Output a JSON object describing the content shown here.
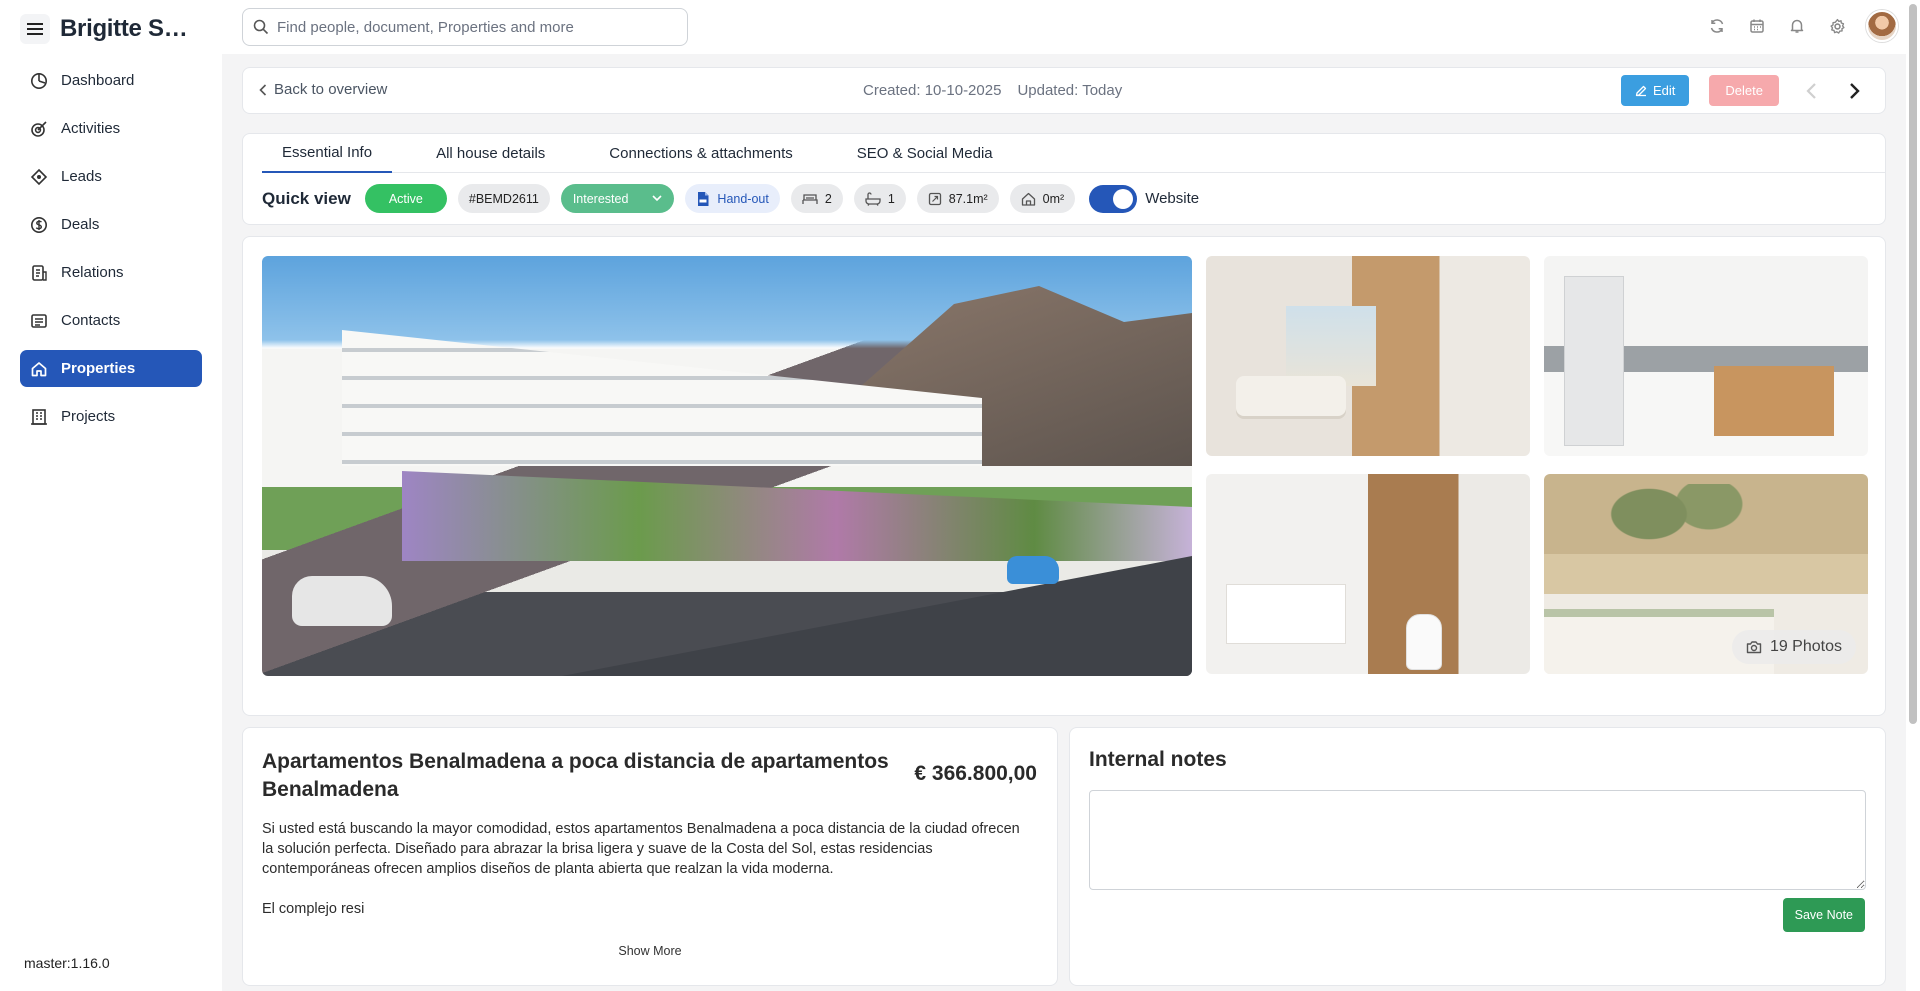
{
  "app": {
    "user_name": "Brigitte Sch..."
  },
  "sidebar": {
    "items": [
      {
        "label": "Dashboard",
        "icon": "dashboard-icon"
      },
      {
        "label": "Activities",
        "icon": "activities-icon"
      },
      {
        "label": "Leads",
        "icon": "leads-icon"
      },
      {
        "label": "Deals",
        "icon": "deals-icon"
      },
      {
        "label": "Relations",
        "icon": "relations-icon"
      },
      {
        "label": "Contacts",
        "icon": "contacts-icon"
      },
      {
        "label": "Properties",
        "icon": "home-icon",
        "active": true
      },
      {
        "label": "Projects",
        "icon": "projects-icon"
      }
    ],
    "version": "master:1.16.0"
  },
  "search": {
    "placeholder": "Find people, document, Properties and more"
  },
  "topbar": {
    "icons": [
      "sync-icon",
      "calendar-icon",
      "bell-icon",
      "gear-icon",
      "avatar"
    ]
  },
  "header": {
    "back_label": "Back to overview",
    "created": "Created: 10-10-2025",
    "updated": "Updated: Today",
    "edit_label": "Edit",
    "delete_label": "Delete"
  },
  "tabs": [
    {
      "label": "Essential Info",
      "active": true
    },
    {
      "label": "All house details"
    },
    {
      "label": "Connections & attachments"
    },
    {
      "label": "SEO & Social Media"
    }
  ],
  "quick_view": {
    "label": "Quick view",
    "status": "Active",
    "reference": "#BEMD2611",
    "interest": "Interested",
    "handout": "Hand-out",
    "bedrooms": "2",
    "bathrooms": "1",
    "living_area": "87.1m²",
    "plot_area": "0m²",
    "website_label": "Website",
    "website_enabled": true
  },
  "gallery": {
    "photos_label": "19 Photos"
  },
  "property": {
    "title": "Apartamentos Benalmadena a poca distancia de apartamentos Benalmadena",
    "price": "€ 366.800,00",
    "description_p1": "Si usted está buscando la mayor comodidad, estos apartamentos Benalmadena a poca distancia de la ciudad ofrecen la solución perfecta. Diseñado para abrazar la brisa ligera y suave de la Costa del Sol, estas residencias contemporáneas ofrecen amplios diseños de planta abierta que realzan la vida moderna.",
    "description_p2": "El complejo resi",
    "show_more": "Show More"
  },
  "notes": {
    "title": "Internal notes",
    "value": "",
    "save_label": "Save Note"
  },
  "colors": {
    "primary": "#2557b8",
    "active_green": "#34c163",
    "interested": "#5abd8c",
    "edit": "#3b9ee0",
    "delete": "#f6a9ac",
    "save": "#2e9a55"
  }
}
